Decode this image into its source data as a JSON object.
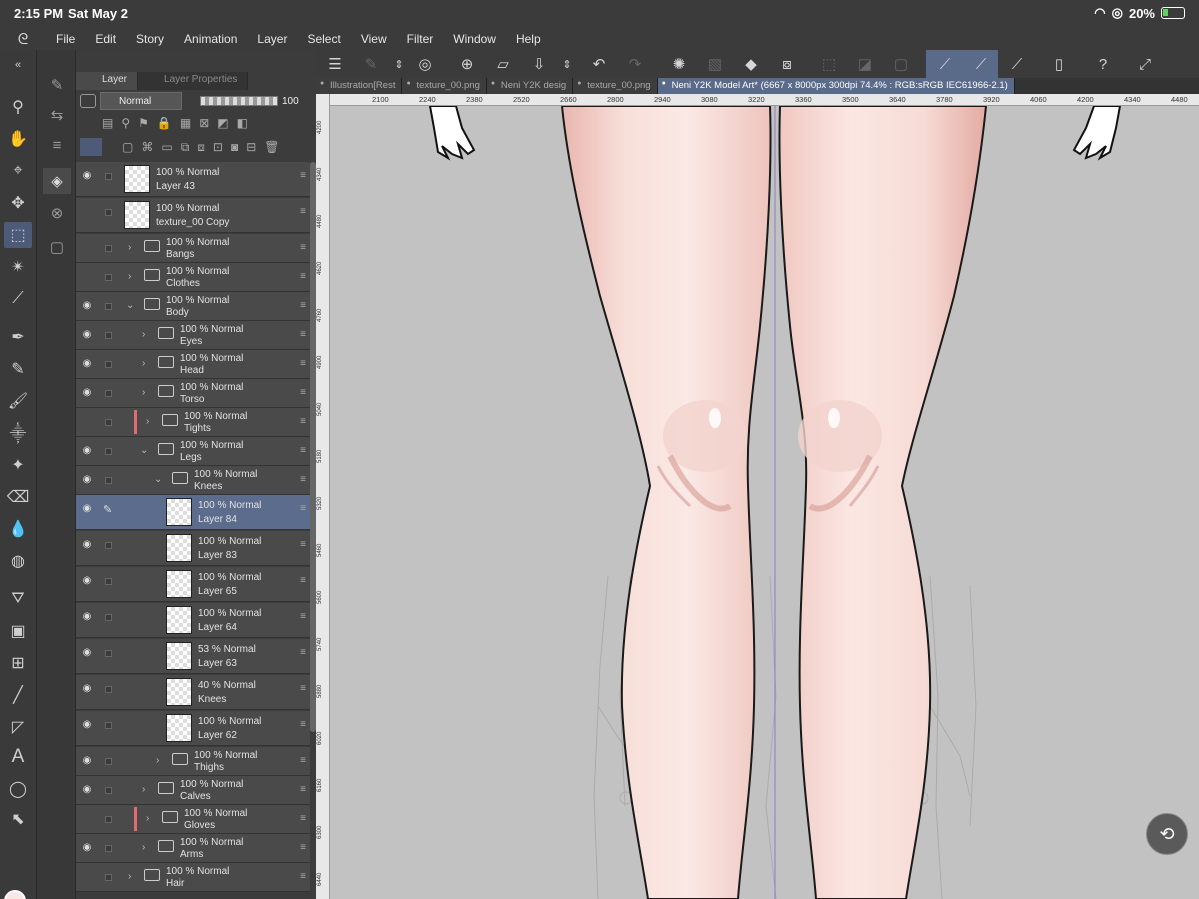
{
  "status": {
    "time": "2:15 PM",
    "date": "Sat May 2",
    "battery": "20%"
  },
  "menu": [
    "File",
    "Edit",
    "Story",
    "Animation",
    "Layer",
    "Select",
    "View",
    "Filter",
    "Window",
    "Help"
  ],
  "layer_panel": {
    "tabs": [
      "Layer",
      "Layer Properties"
    ],
    "blend_mode": "Normal",
    "opacity": "100",
    "layers": [
      {
        "mode": "100 % Normal",
        "name": "Layer 43",
        "type": "layer",
        "visible": true
      },
      {
        "mode": "100 % Normal",
        "name": "texture_00 Copy",
        "type": "layer",
        "visible": false
      },
      {
        "mode": "100 % Normal",
        "name": "Bangs",
        "type": "folder",
        "visible": false
      },
      {
        "mode": "100 % Normal",
        "name": "Clothes",
        "type": "folder",
        "visible": false
      },
      {
        "mode": "100 % Normal",
        "name": "Body",
        "type": "folder-open",
        "visible": true
      },
      {
        "mode": "100 % Normal",
        "name": "Eyes",
        "type": "folder",
        "visible": true
      },
      {
        "mode": "100 % Normal",
        "name": "Head",
        "type": "folder",
        "visible": true
      },
      {
        "mode": "100 % Normal",
        "name": "Torso",
        "type": "folder",
        "visible": true
      },
      {
        "mode": "100 % Normal",
        "name": "Tights",
        "type": "folder",
        "visible": false
      },
      {
        "mode": "100 % Normal",
        "name": "Legs",
        "type": "folder-open",
        "visible": true
      },
      {
        "mode": "100 % Normal",
        "name": "Knees",
        "type": "folder-open",
        "visible": true
      },
      {
        "mode": "100 % Normal",
        "name": "Layer 84",
        "type": "layer",
        "visible": true,
        "selected": true
      },
      {
        "mode": "100 % Normal",
        "name": "Layer 83",
        "type": "layer",
        "visible": true
      },
      {
        "mode": "100 % Normal",
        "name": "Layer 65",
        "type": "layer",
        "visible": true
      },
      {
        "mode": "100 % Normal",
        "name": "Layer 64",
        "type": "layer",
        "visible": true
      },
      {
        "mode": "53 % Normal",
        "name": "Layer 63",
        "type": "layer",
        "visible": true
      },
      {
        "mode": "40 % Normal",
        "name": "Knees",
        "type": "layer",
        "visible": true
      },
      {
        "mode": "100 % Normal",
        "name": "Layer 62",
        "type": "layer",
        "visible": true
      },
      {
        "mode": "100 % Normal",
        "name": "Thighs",
        "type": "folder",
        "visible": true
      },
      {
        "mode": "100 % Normal",
        "name": "Calves",
        "type": "folder",
        "visible": true
      },
      {
        "mode": "100 % Normal",
        "name": "Gloves",
        "type": "folder",
        "visible": false
      },
      {
        "mode": "100 % Normal",
        "name": "Arms",
        "type": "folder",
        "visible": true
      },
      {
        "mode": "100 % Normal",
        "name": "Hair",
        "type": "folder",
        "visible": false
      }
    ]
  },
  "doc_tabs": [
    "Illustration[Rest",
    "texture_00.png",
    "Neni Y2K desig",
    "texture_00.png",
    "Neni Y2K Model Art* (6667 x 8000px 300dpi 74.4% : RGB:sRGB IEC61966-2.1)"
  ],
  "ruler_top": [
    "2100",
    "2240",
    "2380",
    "2520",
    "2660",
    "2800",
    "2940",
    "3080",
    "3220",
    "3360",
    "3500",
    "3640",
    "3780",
    "3920",
    "4060",
    "4200",
    "4340",
    "4480"
  ],
  "ruler_left": [
    "4200",
    "4340",
    "4480",
    "4620",
    "4760",
    "4900",
    "5040",
    "5180",
    "5320",
    "5460",
    "5600",
    "5740",
    "5880",
    "6020",
    "6160",
    "6300",
    "6440"
  ],
  "colors": {
    "accent": "#5a6a89",
    "skin": "#f6dcd6",
    "canvas_bg": "#c2c2c2"
  }
}
